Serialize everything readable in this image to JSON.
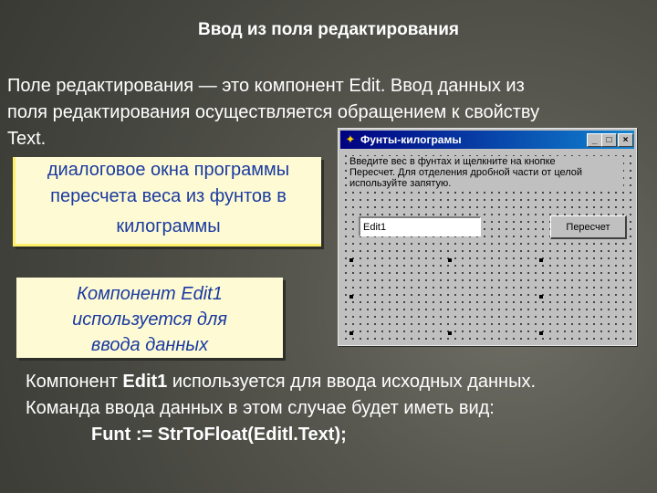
{
  "title": "Ввод из поля редактирования",
  "intro": {
    "line1": "Поле редактирования — это компонент Edit. Ввод данных из",
    "line2": "поля редактирования осуществляется обращением к свойству",
    "line3": "Text."
  },
  "callout_dialog": {
    "line1": "диалоговое окна программы",
    "line2": "пересчета веса из фунтов в",
    "line3": "килограммы"
  },
  "callout_edit": {
    "line1": "Компонент Edit1",
    "line2": "используется для",
    "line3": "ввода данных"
  },
  "form": {
    "caption": "Фунты-килограмы",
    "minimize_glyph": "_",
    "maximize_glyph": "□",
    "close_glyph": "×",
    "hint_line1": "Введите вес в фунтах и щелкните на кнопке",
    "hint_line2": "Пересчет. Для отделения дробной части от целой",
    "hint_line3": "используйте запятую.",
    "edit_value": "Edit1",
    "button_label": "Пересчет",
    "icon": "delphi-form-icon"
  },
  "bottom": {
    "l1_pre": "Компонент ",
    "l1_bold": "Edit1",
    "l1_post": " используется для ввода исходных данных.",
    "line2": "Команда ввода данных в этом случае будет иметь вид:",
    "code": "Funt := StrToFloat(Editl.Text);"
  },
  "colors": {
    "callout_bg": "#fefbd4",
    "callout_text": "#1a3aa0",
    "titlebar": "#000080"
  }
}
